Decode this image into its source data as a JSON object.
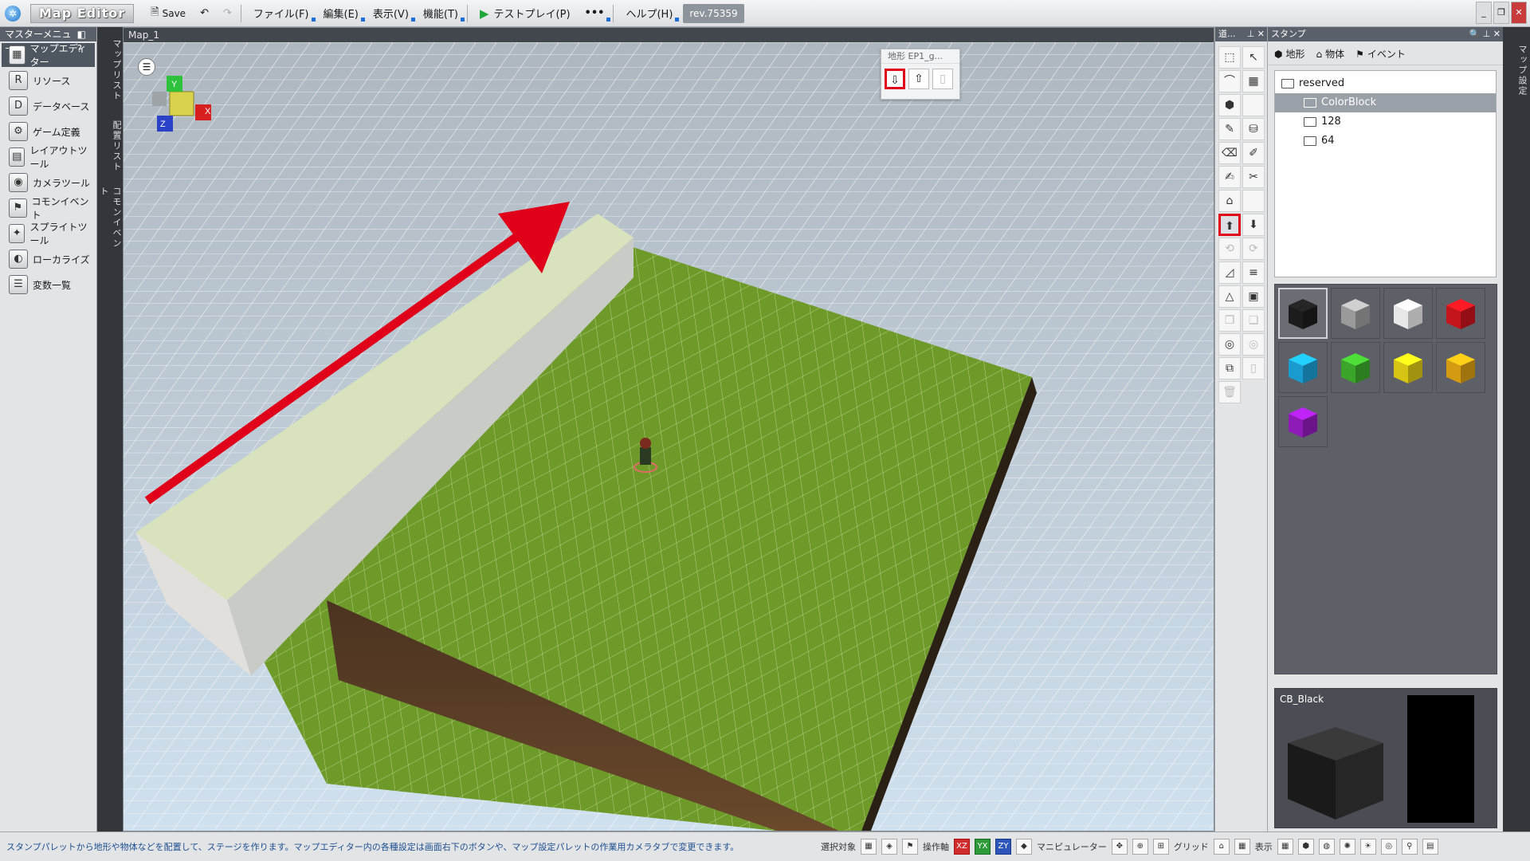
{
  "app": {
    "title": "Map Editor",
    "revision": "rev.75359"
  },
  "toolbar": {
    "save": "Save",
    "menus": [
      "ファイル(F)",
      "編集(E)",
      "表示(V)",
      "機能(T)"
    ],
    "testplay": "テストプレイ(P)",
    "help": "ヘルプ(H)"
  },
  "master_menu": {
    "title": "マスターメニュー",
    "items": [
      {
        "label": "マップエディター",
        "icon": "map-editor-icon"
      },
      {
        "label": "リソース",
        "icon": "resource-icon"
      },
      {
        "label": "データベース",
        "icon": "database-icon"
      },
      {
        "label": "ゲーム定義",
        "icon": "game-definition-icon"
      },
      {
        "label": "レイアウトツール",
        "icon": "layout-tool-icon"
      },
      {
        "label": "カメラツール",
        "icon": "camera-tool-icon"
      },
      {
        "label": "コモンイベント",
        "icon": "common-event-icon"
      },
      {
        "label": "スプライトツール",
        "icon": "sprite-tool-icon"
      },
      {
        "label": "ローカライズ",
        "icon": "localize-icon"
      },
      {
        "label": "変数一覧",
        "icon": "variable-list-icon"
      }
    ]
  },
  "side_tabs": [
    "マップリスト",
    "配置リスト",
    "コモンイベント"
  ],
  "viewport": {
    "tab": "Map_1",
    "float_panel_title": "地形 EP1_g..."
  },
  "tools_panel": {
    "title": "道..."
  },
  "stamp_panel": {
    "title": "スタンプ",
    "tabs": [
      "地形",
      "物体",
      "イベント"
    ],
    "tree": [
      {
        "label": "reserved",
        "level": 0,
        "selected": false
      },
      {
        "label": "ColorBlock",
        "level": 1,
        "selected": true
      },
      {
        "label": "128",
        "level": 1,
        "selected": false
      },
      {
        "label": "64",
        "level": 1,
        "selected": false
      }
    ],
    "swatches": [
      {
        "color": "#1c1c1c",
        "selected": true
      },
      {
        "color": "#9a9a9a"
      },
      {
        "color": "#e8e8e8"
      },
      {
        "color": "#c4141c"
      },
      {
        "color": "#1a9bd0"
      },
      {
        "color": "#3aa52a"
      },
      {
        "color": "#d6c414"
      },
      {
        "color": "#d49a12"
      },
      {
        "color": "#8e1ab8"
      }
    ],
    "preview_label": "CB_Black"
  },
  "right_tab": "マップ設定",
  "status": {
    "message": "スタンプパレットから地形や物体などを配置して、ステージを作ります。マップエディター内の各種設定は画面右下のボタンや、マップ設定パレットの作業用カメラタブで変更できます。",
    "select_target": "選択対象",
    "axis": "操作軸",
    "axis_xz": "XZ",
    "axis_yx": "YX",
    "axis_zy": "ZY",
    "manipulator": "マニピュレーター",
    "grid": "グリッド",
    "display": "表示"
  }
}
